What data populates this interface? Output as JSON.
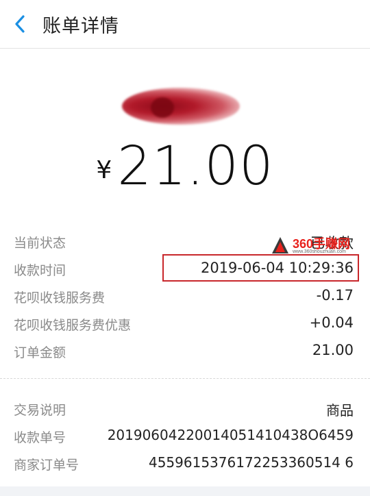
{
  "header": {
    "title": "账单详情",
    "back_icon": "chevron-left-icon",
    "accent_color": "#1a8fe3"
  },
  "payment": {
    "currency_symbol": "¥",
    "amount": "21.00"
  },
  "details": [
    {
      "label": "当前状态",
      "value": "已收款"
    },
    {
      "label": "收款时间",
      "value": "2019-06-04 10:29:36"
    },
    {
      "label": "花呗收钱服务费",
      "value": "-0.17"
    },
    {
      "label": "花呗收钱服务费优惠",
      "value": "+0.04"
    },
    {
      "label": "订单金额",
      "value": "21.00"
    }
  ],
  "transaction": [
    {
      "label": "交易说明",
      "value": "商品"
    },
    {
      "label": "收款单号",
      "value": "20190604220014051410438O6459"
    },
    {
      "label": "商家订单号",
      "value": "4559615376172253360514 6"
    }
  ],
  "watermark": {
    "text": "360手赚网",
    "url": "www.360shouzhuan.com",
    "color": "#e8221d"
  },
  "highlight_color": "#c8262a"
}
